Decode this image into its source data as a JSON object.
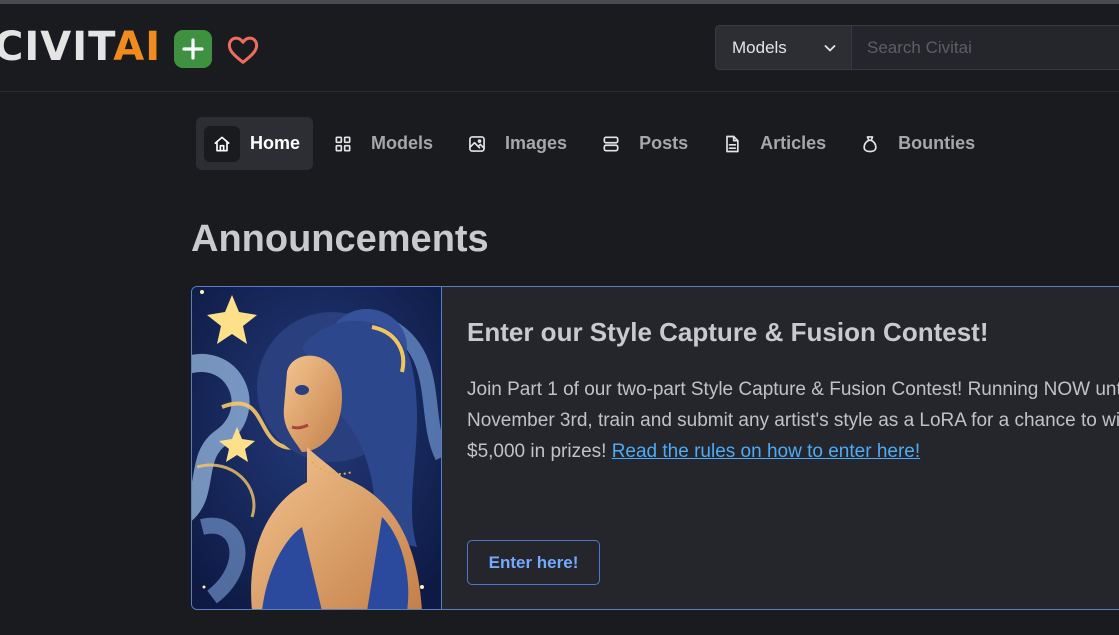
{
  "brand": {
    "civit": "CIVIT",
    "ai": "AI"
  },
  "colors": {
    "accent_green": "#3f9142",
    "accent_orange": "#f08c1e",
    "link": "#4dabf7",
    "card_border": "#5a7dc4"
  },
  "header": {
    "plus_icon": "plus-icon",
    "heart_icon": "heart-icon",
    "search": {
      "selected": "Models",
      "placeholder": "Search Civitai"
    }
  },
  "nav": {
    "items": [
      {
        "label": "Home",
        "icon": "home-icon",
        "active": true
      },
      {
        "label": "Models",
        "icon": "grid-icon"
      },
      {
        "label": "Images",
        "icon": "photo-icon"
      },
      {
        "label": "Posts",
        "icon": "stack-icon"
      },
      {
        "label": "Articles",
        "icon": "file-text-icon"
      },
      {
        "label": "Bounties",
        "icon": "moneybag-icon"
      }
    ]
  },
  "main": {
    "title": "Announcements",
    "announcement": {
      "title": "Enter our Style Capture & Fusion Contest!",
      "body": "Join Part 1 of our two-part Style Capture & Fusion Contest! Running NOW until November 3rd, train and submit any artist's style as a LoRA for a chance to win $5,000 in prizes! ",
      "link": "Read the rules on how to enter here!",
      "button": "Enter here!"
    }
  }
}
